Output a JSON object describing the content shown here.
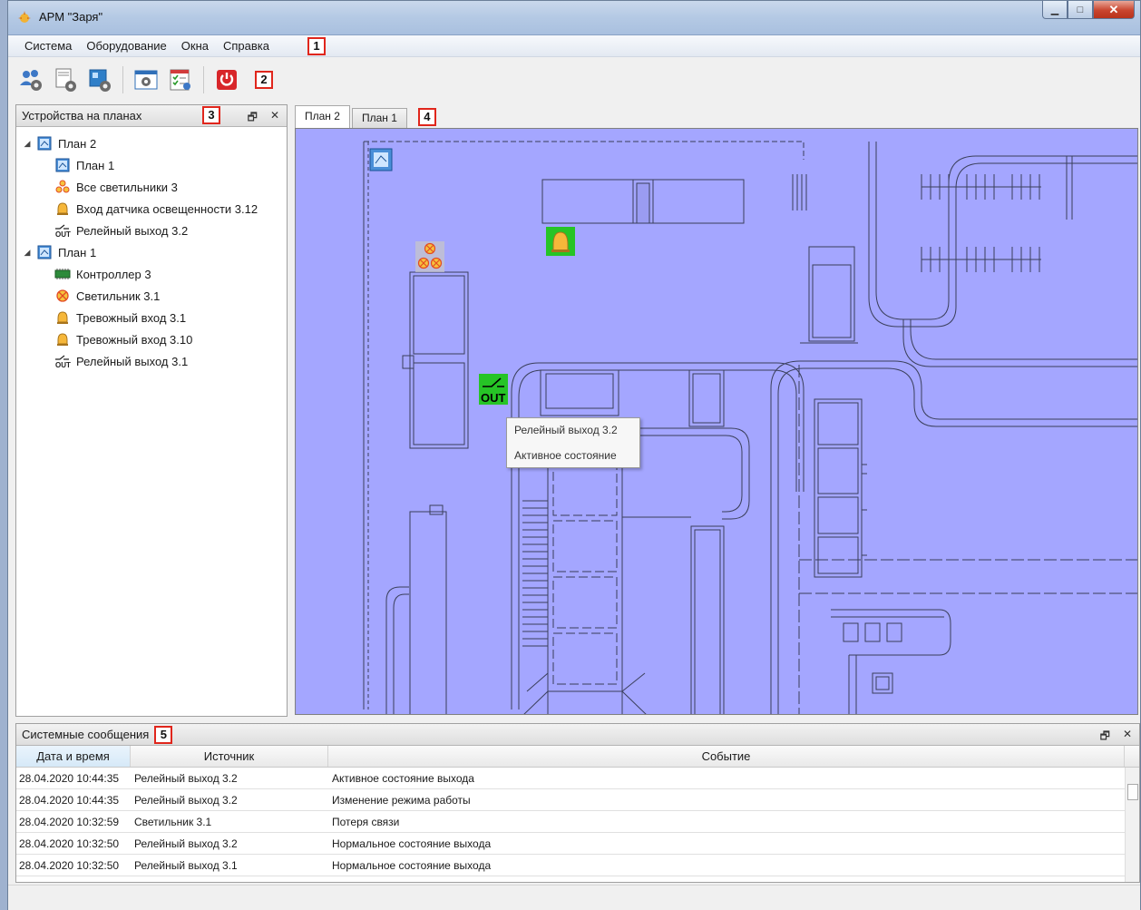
{
  "window": {
    "title": "АРМ \"Заря\"",
    "minimize": "▁",
    "maximize": "□",
    "close": "✕"
  },
  "menu": {
    "items": [
      "Система",
      "Оборудование",
      "Окна",
      "Справка"
    ],
    "marker": "1"
  },
  "toolbar": {
    "marker": "2",
    "buttons": [
      "users-settings-icon",
      "server-settings-icon",
      "plan-settings-icon",
      "window-settings-icon",
      "schedule-icon",
      "power-icon"
    ]
  },
  "devices_panel": {
    "title": "Устройства на планах",
    "marker": "3",
    "float_glyph": "🗗",
    "close_glyph": "✕",
    "tree": [
      {
        "label": "План 2",
        "icon": "plan-icon",
        "level": 0,
        "expand": "◢"
      },
      {
        "label": "План 1",
        "icon": "plan-icon",
        "level": 1
      },
      {
        "label": "Все светильники 3",
        "icon": "lamp-group-icon",
        "level": 1
      },
      {
        "label": "Вход датчика освещенности 3.12",
        "icon": "bell-icon",
        "level": 1
      },
      {
        "label": "Релейный выход 3.2",
        "icon": "relay-out-icon",
        "level": 1
      },
      {
        "label": "План 1",
        "icon": "plan-icon",
        "level": 0,
        "expand": "◢"
      },
      {
        "label": "Контроллер 3",
        "icon": "controller-icon",
        "level": 1
      },
      {
        "label": "Светильник 3.1",
        "icon": "lamp-icon",
        "level": 1
      },
      {
        "label": "Тревожный вход 3.1",
        "icon": "bell-icon",
        "level": 1
      },
      {
        "label": "Тревожный вход 3.10",
        "icon": "bell-icon",
        "level": 1
      },
      {
        "label": "Релейный выход 3.1",
        "icon": "relay-out-icon",
        "level": 1
      }
    ]
  },
  "plan_tabs": {
    "tabs": [
      "План 2",
      "План 1"
    ],
    "active": 0,
    "marker": "4"
  },
  "plan": {
    "background": "#a4a6ff",
    "relay_text": "OUT",
    "tooltip": {
      "title": "Релейный выход 3.2",
      "state": "Активное состояние"
    }
  },
  "messages": {
    "title": "Системные сообщения",
    "marker": "5",
    "float_glyph": "🗗",
    "close_glyph": "✕",
    "columns": [
      "Дата и время",
      "Источник",
      "Событие"
    ],
    "rows": [
      [
        "28.04.2020 10:44:35",
        "Релейный выход 3.2",
        "Активное состояние выхода"
      ],
      [
        "28.04.2020 10:44:35",
        "Релейный выход 3.2",
        "Изменение режима работы"
      ],
      [
        "28.04.2020 10:32:59",
        "Светильник 3.1",
        "Потеря связи"
      ],
      [
        "28.04.2020 10:32:50",
        "Релейный выход 3.2",
        "Нормальное состояние выхода"
      ],
      [
        "28.04.2020 10:32:50",
        "Релейный выход 3.1",
        "Нормальное состояние выхода"
      ]
    ]
  }
}
